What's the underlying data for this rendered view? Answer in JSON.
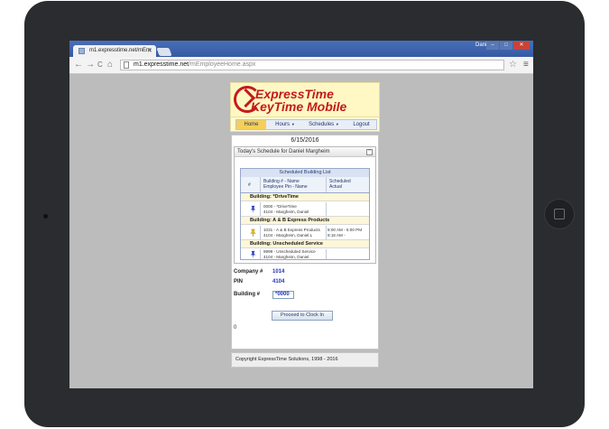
{
  "browser": {
    "tab_title": "m1.expresstime.net/mEm",
    "user_name": "Daniel",
    "url_domain": "m1.expresstime.net",
    "url_path": "/mEmployeeHome.aspx",
    "back": "←",
    "forward": "→",
    "reload": "C",
    "home": "⌂",
    "star": "☆",
    "menu": "≡",
    "win_min": "–",
    "win_max": "□",
    "win_close": "✕"
  },
  "logo": {
    "line1": "ExpressTime",
    "line2": "KeyTime Mobile"
  },
  "nav": {
    "home": "Home",
    "hours": "Hours",
    "schedules": "Schedules",
    "logout": "Logout",
    "arrow": "▼"
  },
  "date": "6/15/2016",
  "schedule_panel": {
    "title": "Today's Schedule for Daniel Margheim",
    "toggle": "^",
    "table_caption": "Scheduled Building List",
    "headers": {
      "num": "#",
      "building_line1": "Building # - Name",
      "building_line2": "Employee Pin - Name",
      "sched_line1": "Scheduled",
      "sched_line2": "Actual"
    },
    "groups": [
      {
        "building": "Building: *DriveTime",
        "entry_line1": "0000 - *DriveTime",
        "entry_line2": "4104 - Margheim, Daniel",
        "sched_line1": "",
        "sched_line2": "",
        "pin_color": "#2c3ec8"
      },
      {
        "building": "Building: A & B Express Products",
        "entry_line1": "1031 - A & B Express Products",
        "entry_line2": "4104 - Margheim, Daniel L",
        "sched_line1": "8:00 AM - 5:00 PM",
        "sched_line2": "8:16 AM -",
        "pin_color": "#e4b91c"
      },
      {
        "building": "Building: Unscheduled Service",
        "entry_line1": "9999 - Unscheduled Service",
        "entry_line2": "4104 - Margheim, Daniel",
        "sched_line1": "",
        "sched_line2": "",
        "pin_color": "#2c3ec8"
      }
    ]
  },
  "form": {
    "company_label": "Company #",
    "company_value": "1014",
    "pin_label": "PIN",
    "pin_value": "4104",
    "building_label": "Building #",
    "building_value": "*0000",
    "proceed_label": "Proceed to Clock In",
    "counter": "0"
  },
  "footer": "Copyright ExpressTime Solutions, 1998 - 2016"
}
